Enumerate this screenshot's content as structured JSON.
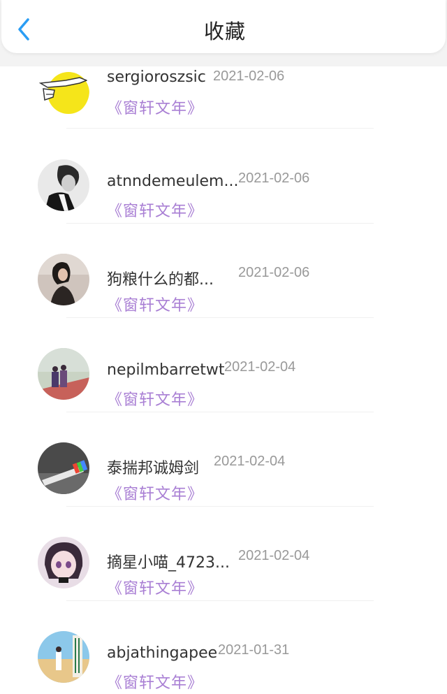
{
  "header": {
    "title": "收藏",
    "back_icon": "chevron-left-icon",
    "accent_color": "#2a9df4"
  },
  "items": [
    {
      "name": "sergioroszsic",
      "date": "2021-02-06",
      "work": "《窗轩文年》"
    },
    {
      "name": "atnndemeulem...",
      "date": "2021-02-06",
      "work": "《窗轩文年》"
    },
    {
      "name": "狗粮什么的都...",
      "date": "2021-02-06",
      "work": "《窗轩文年》"
    },
    {
      "name": "nepilmbarretwt",
      "date": "2021-02-04",
      "work": "《窗轩文年》"
    },
    {
      "name": "泰揣邦诚姆剑",
      "date": "2021-02-04",
      "work": "《窗轩文年》"
    },
    {
      "name": "摘星小喵_4723...",
      "date": "2021-02-04",
      "work": "《窗轩文年》"
    },
    {
      "name": "abjathingapee",
      "date": "2021-01-31",
      "work": "《窗轩文年》"
    }
  ],
  "colors": {
    "name": "#333333",
    "date": "#999999",
    "work": "#a97fd4"
  }
}
